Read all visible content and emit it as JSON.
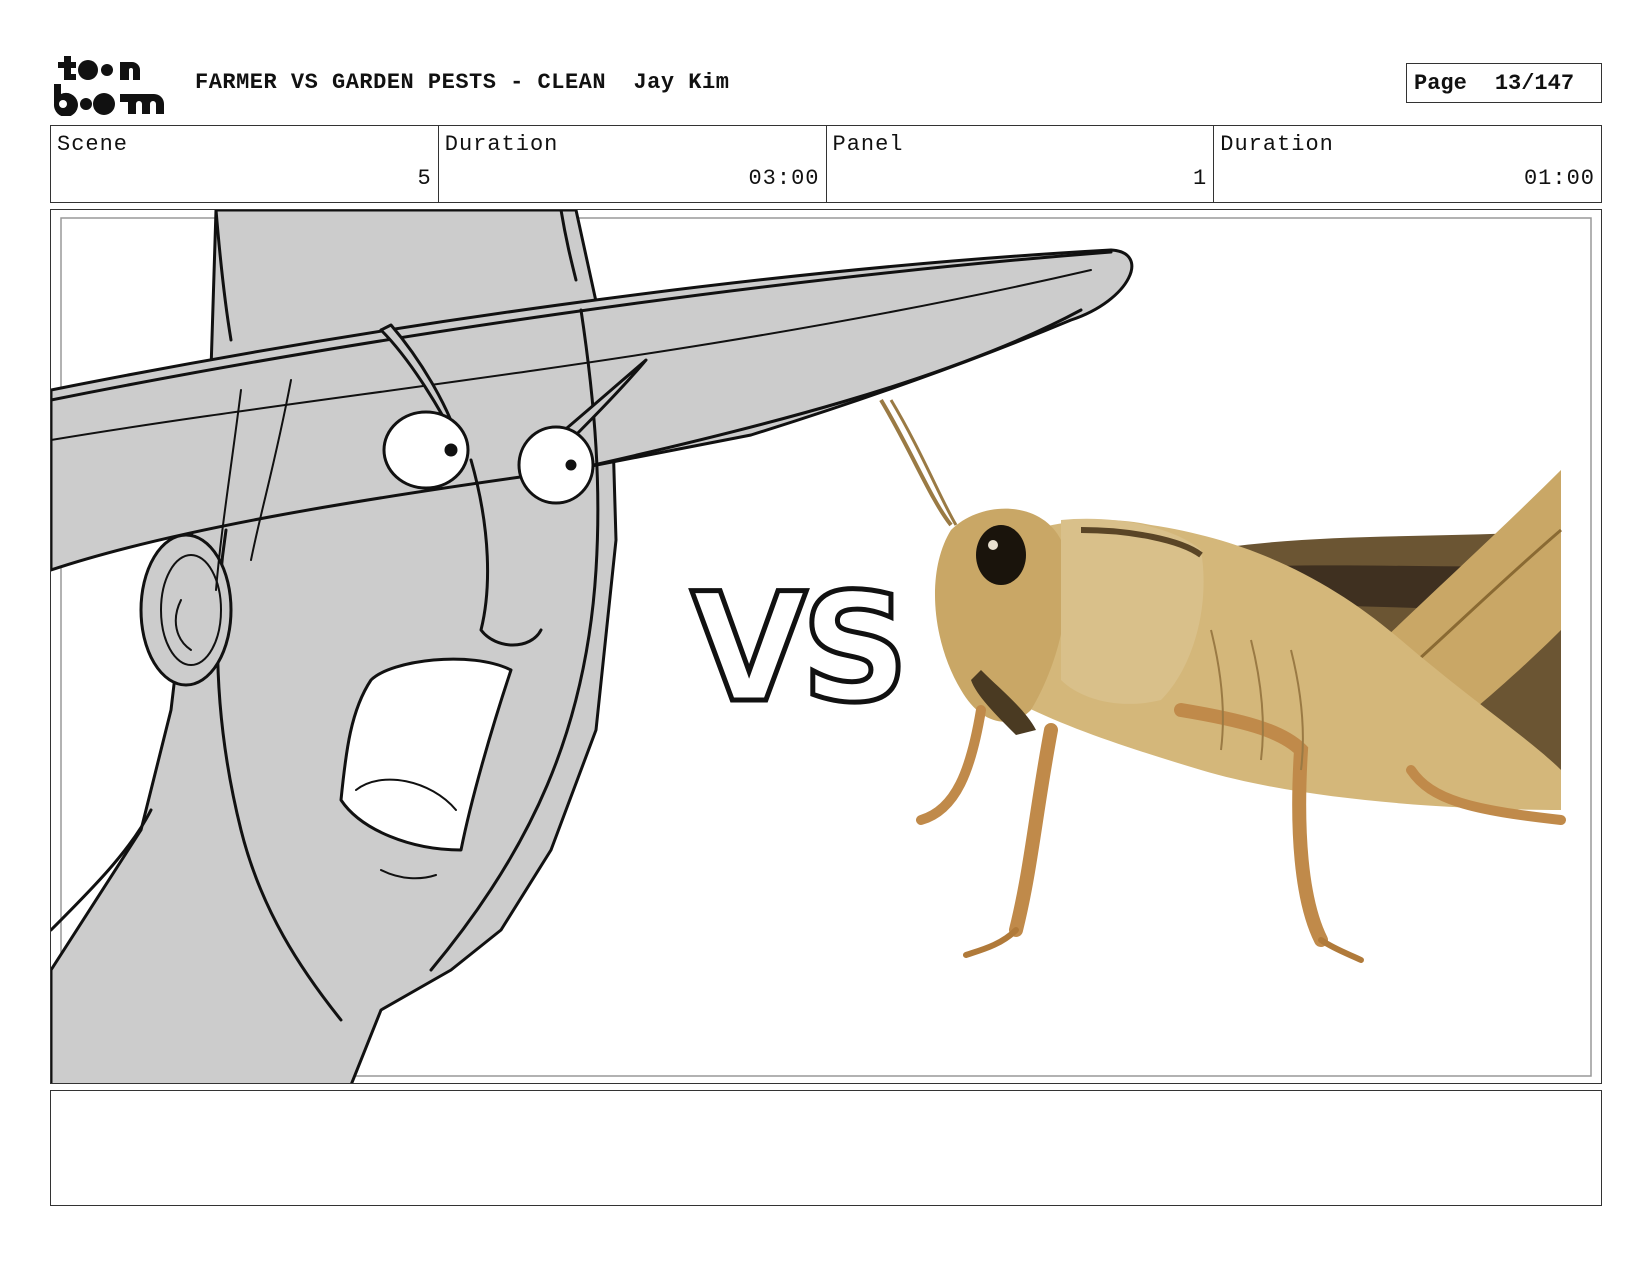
{
  "header": {
    "project_title": "FARMER VS GARDEN PESTS - CLEAN",
    "author": "Jay Kim",
    "page_label": "Page",
    "page_number": "13/147"
  },
  "logo": {
    "alt": "toon boom"
  },
  "info": {
    "scene_label": "Scene",
    "scene_value": "5",
    "scene_duration_label": "Duration",
    "scene_duration_value": "03:00",
    "panel_label": "Panel",
    "panel_value": "1",
    "panel_duration_label": "Duration",
    "panel_duration_value": "01:00"
  },
  "panel_art": {
    "vs_text": "VS",
    "left_subject": "farmer-sketch",
    "right_subject": "grasshopper-photo"
  },
  "colors": {
    "sketch_fill": "#cccccc",
    "grasshopper_body": "#c9a766",
    "grasshopper_dark": "#4a3a22",
    "border": "#333333"
  },
  "notes": {
    "text": ""
  }
}
